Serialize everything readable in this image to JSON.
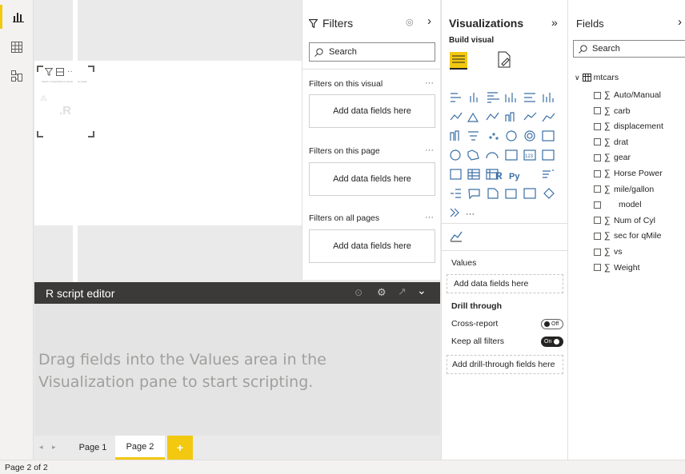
{
  "status": {
    "page_info": "Page 2 of 2"
  },
  "canvas": {
    "visual_hint": "Select or drag fields to populate this visual",
    "visual_letter": ".R"
  },
  "r_editor": {
    "title": "R script editor",
    "message": "Drag fields into the Values area in the Visualization pane to start scripting."
  },
  "pages": {
    "tabs": [
      "Page 1",
      "Page 2"
    ],
    "active": "Page 2",
    "add": "+"
  },
  "filters": {
    "title": "Filters",
    "search_placeholder": "Search",
    "sections": [
      {
        "label": "Filters on this visual",
        "well": "Add data fields here"
      },
      {
        "label": "Filters on this page",
        "well": "Add data fields here"
      },
      {
        "label": "Filters on all pages",
        "well": "Add data fields here"
      }
    ]
  },
  "visualizations": {
    "title": "Visualizations",
    "build_visual": "Build visual",
    "values_label": "Values",
    "values_well": "Add data fields here",
    "drill_through": "Drill through",
    "cross_report": "Cross-report",
    "cross_report_state": "Off",
    "keep_all_filters": "Keep all filters",
    "keep_all_filters_state": "On",
    "drill_well": "Add drill-through fields here",
    "more": "···",
    "r_icon": "R",
    "py_icon": "Py",
    "num_icon": "123"
  },
  "fields": {
    "title": "Fields",
    "search_placeholder": "Search",
    "table": "mtcars",
    "items": [
      {
        "name": "Auto/Manual",
        "sigma": true
      },
      {
        "name": "carb",
        "sigma": true
      },
      {
        "name": "displacement",
        "sigma": true
      },
      {
        "name": "drat",
        "sigma": true
      },
      {
        "name": "gear",
        "sigma": true
      },
      {
        "name": "Horse Power",
        "sigma": true
      },
      {
        "name": "mile/gallon",
        "sigma": true
      },
      {
        "name": "model",
        "sigma": false
      },
      {
        "name": "Num of Cyl",
        "sigma": true
      },
      {
        "name": "sec for qMile",
        "sigma": true
      },
      {
        "name": "vs",
        "sigma": true
      },
      {
        "name": "Weight",
        "sigma": true
      }
    ]
  },
  "colors": {
    "accent": "#f2c811",
    "editor_bar": "#3b3a39",
    "toggle_on": "#252423"
  }
}
